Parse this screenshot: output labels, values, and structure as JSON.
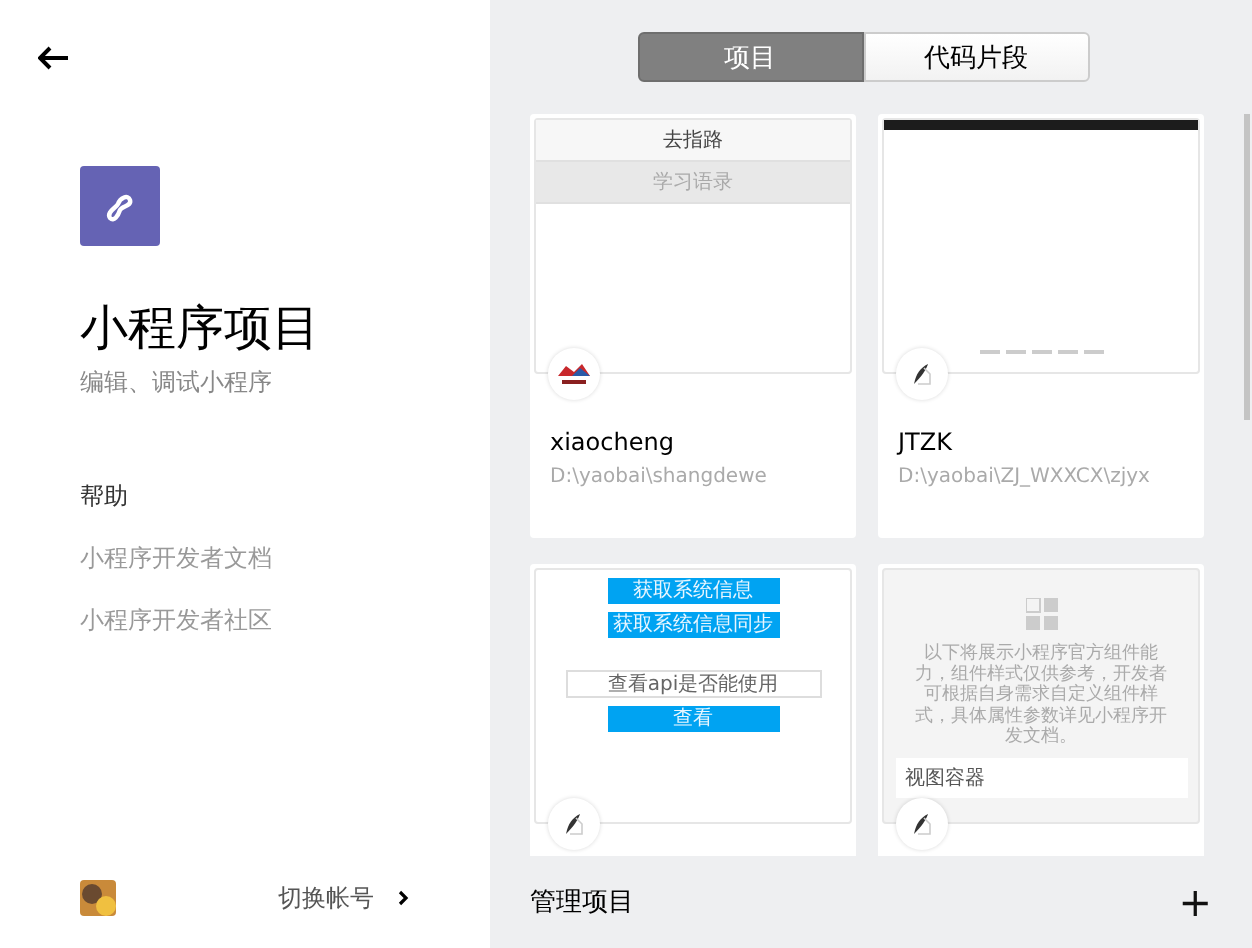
{
  "sidebar": {
    "title": "小程序项目",
    "subtitle": "编辑、调试小程序",
    "help": {
      "heading": "帮助",
      "links": [
        "小程序开发者文档",
        "小程序开发者社区"
      ]
    },
    "account": {
      "label": "切换帐号"
    }
  },
  "tabs": [
    {
      "label": "项目",
      "selected": true
    },
    {
      "label": "代码片段",
      "selected": false
    }
  ],
  "projects": [
    {
      "kind": "menu",
      "preview": [
        "去指路",
        "学习语录"
      ],
      "name": "xiaocheng",
      "path": "D:\\yaobai\\shangdewe",
      "avatar": {
        "kind": "logo"
      }
    },
    {
      "kind": "carousel",
      "name": "JTZK",
      "path": "D:\\yaobai\\ZJ_WXXCX\\zjyx",
      "avatar": {
        "kind": "quill"
      }
    },
    {
      "kind": "api",
      "preview": [
        "获取系统信息",
        "获取系统信息同步"
      ],
      "field": "查看api是否能使用",
      "action": "查看",
      "avatar": {
        "kind": "quill"
      }
    },
    {
      "kind": "components",
      "intro": "以下将展示小程序官方组件能力，组件样式仅供参考，开发者可根据自身需求自定义组件样式，具体属性参数详见小程序开发文档。",
      "rows": [
        "视图容器"
      ],
      "avatar": {
        "kind": "quill"
      }
    }
  ],
  "footer": {
    "label": "管理项目",
    "add": "+"
  }
}
